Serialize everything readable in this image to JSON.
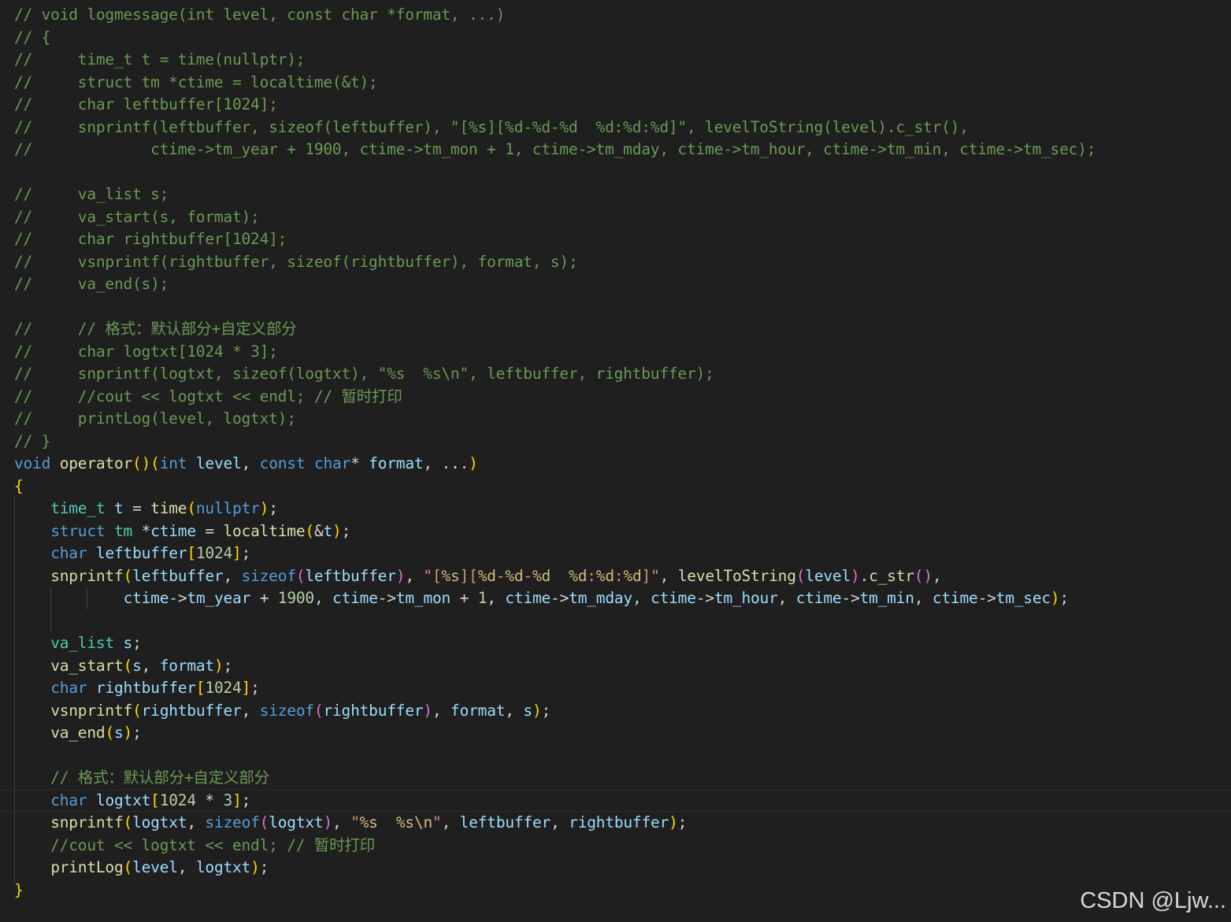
{
  "editor": {
    "language": "cpp",
    "theme": "dark",
    "current_line_index": 35,
    "lines": [
      "// void logmessage(int level, const char *format, ...)",
      "// {",
      "//     time_t t = time(nullptr);",
      "//     struct tm *ctime = localtime(&t);",
      "//     char leftbuffer[1024];",
      "//     snprintf(leftbuffer, sizeof(leftbuffer), \"[%s][%d-%d-%d  %d:%d:%d]\", levelToString(level).c_str(),",
      "//             ctime->tm_year + 1900, ctime->tm_mon + 1, ctime->tm_mday, ctime->tm_hour, ctime->tm_min, ctime->tm_sec);",
      "",
      "//     va_list s;",
      "//     va_start(s, format);",
      "//     char rightbuffer[1024];",
      "//     vsnprintf(rightbuffer, sizeof(rightbuffer), format, s);",
      "//     va_end(s);",
      "",
      "//     // 格式：默认部分+自定义部分",
      "//     char logtxt[1024 * 3];",
      "//     snprintf(logtxt, sizeof(logtxt), \"%s  %s\\n\", leftbuffer, rightbuffer);",
      "//     //cout << logtxt << endl; // 暂时打印",
      "//     printLog(level, logtxt);",
      "// }",
      "void operator()(int level, const char* format, ...)",
      "{",
      "    time_t t = time(nullptr);",
      "    struct tm *ctime = localtime(&t);",
      "    char leftbuffer[1024];",
      "    snprintf(leftbuffer, sizeof(leftbuffer), \"[%s][%d-%d-%d  %d:%d:%d]\", levelToString(level).c_str(),",
      "            ctime->tm_year + 1900, ctime->tm_mon + 1, ctime->tm_mday, ctime->tm_hour, ctime->tm_min, ctime->tm_sec);",
      "",
      "    va_list s;",
      "    va_start(s, format);",
      "    char rightbuffer[1024];",
      "    vsnprintf(rightbuffer, sizeof(rightbuffer), format, s);",
      "    va_end(s);",
      "",
      "    // 格式：默认部分+自定义部分",
      "    char logtxt[1024 * 3];",
      "    snprintf(logtxt, sizeof(logtxt), \"%s  %s\\n\", leftbuffer, rightbuffer);",
      "    //cout << logtxt << endl; // 暂时打印",
      "    printLog(level, logtxt);",
      "}"
    ]
  },
  "colors": {
    "background": "#1f1f1f",
    "comment": "#6a9955",
    "keyword": "#569cd6",
    "type": "#4ec9b0",
    "function": "#dcdcaa",
    "variable": "#9cdcfe",
    "string": "#ce9178",
    "number": "#b5cea8"
  },
  "watermark": "CSDN @Ljw..."
}
